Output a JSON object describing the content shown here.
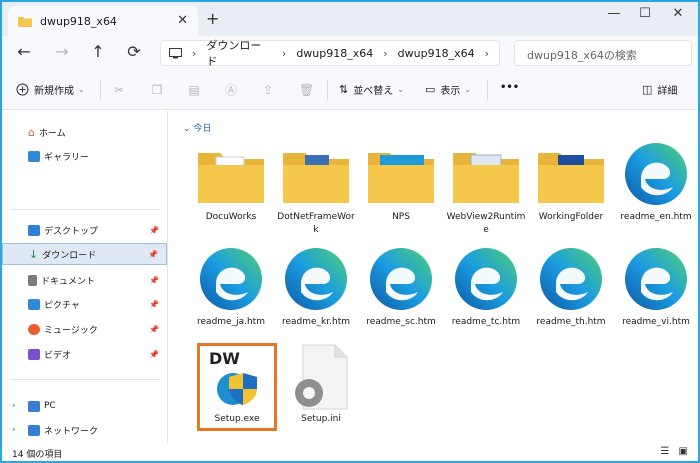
{
  "window": {
    "tab_title": "dwup918_x64",
    "tab_close": "✕",
    "new_tab": "+",
    "minimize": "—",
    "maximize": "☐",
    "close": "✕"
  },
  "nav": {
    "back": "←",
    "forward": "→",
    "up": "↑",
    "refresh": "⟳",
    "breadcrumb": [
      "ダウンロード",
      "dwup918_x64",
      "dwup918_x64"
    ],
    "search_placeholder": "dwup918_x64の検索"
  },
  "commands": {
    "new_label": "新規作成",
    "sort_label": "並べ替え",
    "view_label": "表示",
    "more": "•••",
    "details_label": "詳細"
  },
  "sidebar": {
    "top_items": [
      {
        "label": "ホーム",
        "icon": "home-icon"
      },
      {
        "label": "ギャラリー",
        "icon": "gallery-icon"
      }
    ],
    "pinned_items": [
      {
        "label": "デスクトップ",
        "icon": "desktop-icon",
        "color": "#2f7fd6"
      },
      {
        "label": "ダウンロード",
        "icon": "download-icon",
        "color": "#1f8b4c"
      },
      {
        "label": "ドキュメント",
        "icon": "document-icon",
        "color": "#7a7a7a"
      },
      {
        "label": "ピクチャ",
        "icon": "pictures-icon",
        "color": "#2f89d6"
      },
      {
        "label": "ミュージック",
        "icon": "music-icon",
        "color": "#e85d2a"
      },
      {
        "label": "ビデオ",
        "icon": "video-icon",
        "color": "#7c4dcc"
      }
    ],
    "bottom_items": [
      {
        "label": "PC",
        "icon": "pc-icon"
      },
      {
        "label": "ネットワーク",
        "icon": "network-icon"
      }
    ]
  },
  "main": {
    "group_label": "今日",
    "items": [
      {
        "name": "DocuWorks",
        "type": "folder"
      },
      {
        "name": "DotNetFrameWork",
        "type": "folder"
      },
      {
        "name": "NPS",
        "type": "folder"
      },
      {
        "name": "WebView2Runtime",
        "type": "folder"
      },
      {
        "name": "WorkingFolder",
        "type": "folder"
      },
      {
        "name": "readme_en.htm",
        "type": "edge"
      },
      {
        "name": "readme_ja.htm",
        "type": "edge"
      },
      {
        "name": "readme_kr.htm",
        "type": "edge"
      },
      {
        "name": "readme_sc.htm",
        "type": "edge"
      },
      {
        "name": "readme_tc.htm",
        "type": "edge"
      },
      {
        "name": "readme_th.htm",
        "type": "edge"
      },
      {
        "name": "readme_vi.htm",
        "type": "edge"
      },
      {
        "name": "Setup.exe",
        "type": "exe",
        "icon_text": "DW"
      },
      {
        "name": "Setup.ini",
        "type": "ini"
      }
    ]
  },
  "status": {
    "count_text": "14 個の項目"
  },
  "colors": {
    "folder": "#f5c84c",
    "highlight": "#e87722",
    "accent": "#1a5fb4"
  }
}
